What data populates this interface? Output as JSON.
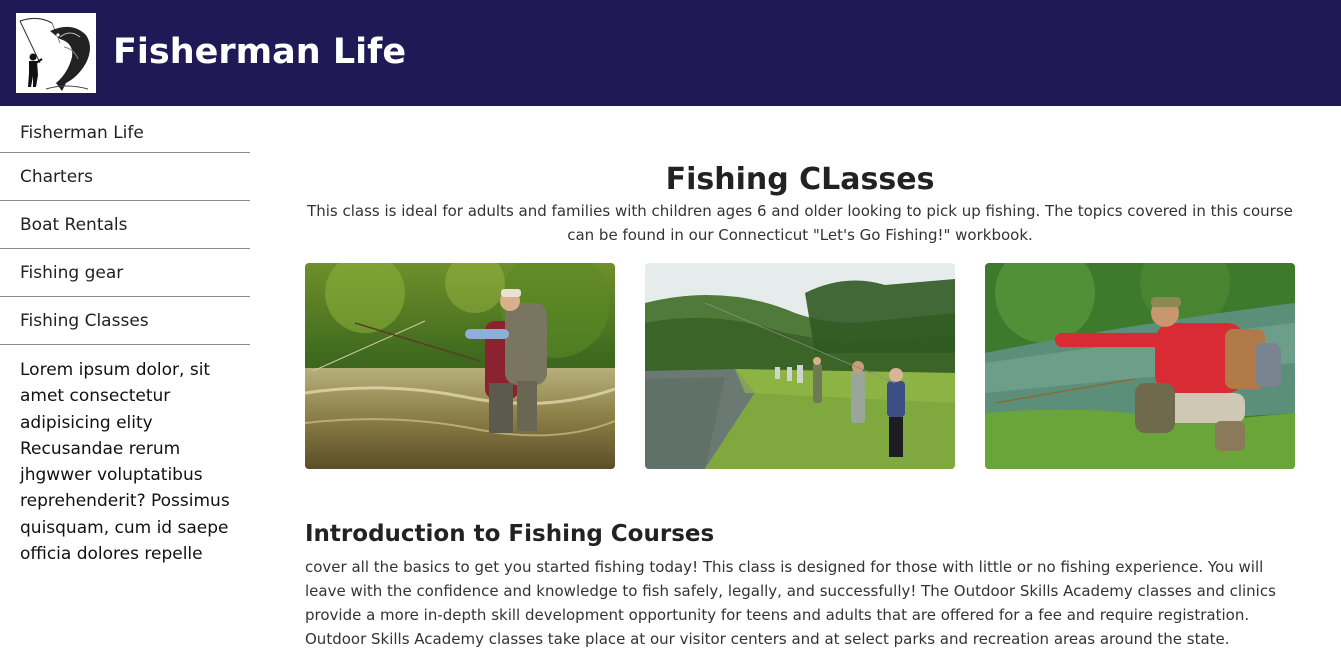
{
  "header": {
    "site_title": "Fisherman Life",
    "logo_icon": "fisherman-fish-logo-icon"
  },
  "sidebar": {
    "items": [
      {
        "label": "Fisherman Life"
      },
      {
        "label": "Charters"
      },
      {
        "label": "Boat Rentals"
      },
      {
        "label": "Fishing gear"
      },
      {
        "label": "Fishing Classes"
      }
    ],
    "text": "Lorem ipsum dolor, sit amet consectetur adipisicing elity Recusandae rerum jhgwwer voluptatibus reprehenderit? Possimus quisquam, cum id saepe officia dolores repelle"
  },
  "main": {
    "heading": "Fishing CLasses",
    "intro": "This class is ideal for adults and families with children ages 6 and older looking to pick up fishing. The topics covered in this course can be found in our Connecticut \"Let's Go Fishing!\" workbook.",
    "photos": [
      {
        "subject": "fly-fishing-instruction-in-stream"
      },
      {
        "subject": "casting-class-on-riverside-lawn"
      },
      {
        "subject": "instructor-pointing-at-river"
      }
    ],
    "section_heading": "Introduction to Fishing Courses",
    "section_text": "cover all the basics to get you started fishing today! This class is designed for those with little or no fishing experience. You will leave with the confidence and knowledge to fish safely, legally, and successfully! The Outdoor Skills Academy classes and clinics provide a more in-depth skill development opportunity for teens and adults that are offered for a fee and require registration. Outdoor Skills Academy classes take place at our visitor centers and at select parks and recreation areas around the state."
  },
  "colors": {
    "header_bg": "#1f1a56",
    "header_text": "#ffffff",
    "divider": "#8a8a8a"
  }
}
